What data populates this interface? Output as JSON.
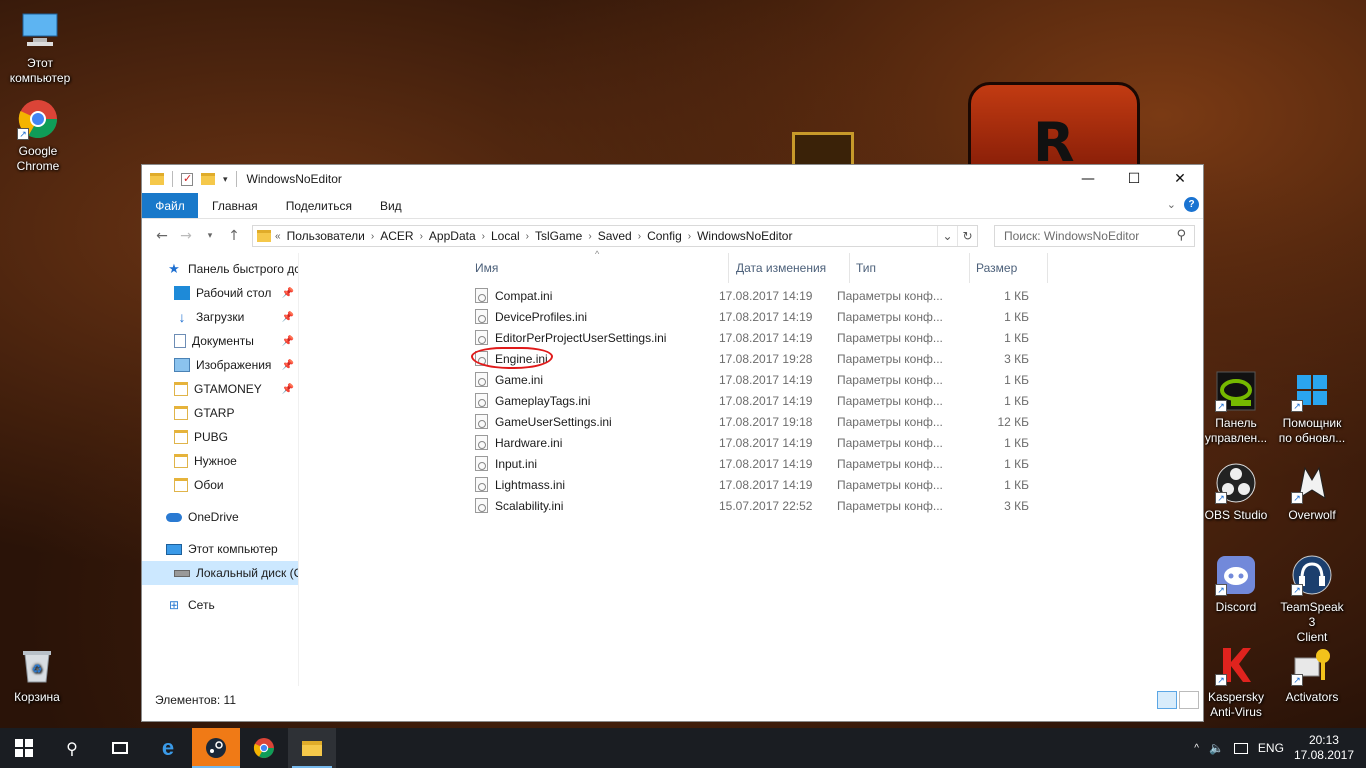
{
  "desktop": {
    "icons_left": [
      {
        "name": "this-pc",
        "label": "Этот\nкомпьютер"
      },
      {
        "name": "google-chrome",
        "label": "Google\nChrome"
      },
      {
        "name": "recycle-bin",
        "label": "Корзина"
      }
    ],
    "icons_right": [
      {
        "label": "Панель\nуправлен..."
      },
      {
        "label": "Помощник\nпо обновл..."
      },
      {
        "label": "OBS Studio"
      },
      {
        "label": "Overwolf"
      },
      {
        "label": "Discord"
      },
      {
        "label": "TeamSpeak 3\nClient"
      },
      {
        "label": "Kaspersky\nAnti-Virus"
      },
      {
        "label": "Activators"
      }
    ]
  },
  "window": {
    "title": "WindowsNoEditor",
    "ribbon_tabs": [
      "Файл",
      "Главная",
      "Поделиться",
      "Вид"
    ],
    "breadcrumbs": [
      "Пользователи",
      "ACER",
      "AppData",
      "Local",
      "TslGame",
      "Saved",
      "Config",
      "WindowsNoEditor"
    ],
    "breadcrumb_prefix": "«",
    "search_placeholder": "Поиск: WindowsNoEditor",
    "nav": {
      "quick_access": "Панель быстрого дс",
      "items": [
        {
          "label": "Рабочий стол",
          "pinned": true,
          "icon": "desktop"
        },
        {
          "label": "Загрузки",
          "pinned": true,
          "icon": "downloads"
        },
        {
          "label": "Документы",
          "pinned": true,
          "icon": "documents"
        },
        {
          "label": "Изображения",
          "pinned": true,
          "icon": "pictures"
        },
        {
          "label": "GTAMONEY",
          "pinned": true,
          "icon": "folder"
        },
        {
          "label": "GTARP",
          "pinned": false,
          "icon": "folder"
        },
        {
          "label": "PUBG",
          "pinned": false,
          "icon": "folder"
        },
        {
          "label": "Нужное",
          "pinned": false,
          "icon": "folder"
        },
        {
          "label": "Обои",
          "pinned": false,
          "icon": "folder"
        }
      ],
      "onedrive": "OneDrive",
      "this_pc": "Этот компьютер",
      "local_disk": "Локальный диск (C",
      "network": "Сеть"
    },
    "columns": {
      "name": "Имя",
      "date": "Дата изменения",
      "type": "Тип",
      "size": "Размер"
    },
    "files": [
      {
        "name": "Compat.ini",
        "date": "17.08.2017 14:19",
        "type": "Параметры конф...",
        "size": "1 КБ"
      },
      {
        "name": "DeviceProfiles.ini",
        "date": "17.08.2017 14:19",
        "type": "Параметры конф...",
        "size": "1 КБ"
      },
      {
        "name": "EditorPerProjectUserSettings.ini",
        "date": "17.08.2017 14:19",
        "type": "Параметры конф...",
        "size": "1 КБ"
      },
      {
        "name": "Engine.ini",
        "date": "17.08.2017 19:28",
        "type": "Параметры конф...",
        "size": "3 КБ",
        "highlighted": true
      },
      {
        "name": "Game.ini",
        "date": "17.08.2017 14:19",
        "type": "Параметры конф...",
        "size": "1 КБ"
      },
      {
        "name": "GameplayTags.ini",
        "date": "17.08.2017 14:19",
        "type": "Параметры конф...",
        "size": "1 КБ"
      },
      {
        "name": "GameUserSettings.ini",
        "date": "17.08.2017 19:18",
        "type": "Параметры конф...",
        "size": "12 КБ"
      },
      {
        "name": "Hardware.ini",
        "date": "17.08.2017 14:19",
        "type": "Параметры конф...",
        "size": "1 КБ"
      },
      {
        "name": "Input.ini",
        "date": "17.08.2017 14:19",
        "type": "Параметры конф...",
        "size": "1 КБ"
      },
      {
        "name": "Lightmass.ini",
        "date": "17.08.2017 14:19",
        "type": "Параметры конф...",
        "size": "1 КБ"
      },
      {
        "name": "Scalability.ini",
        "date": "15.07.2017 22:52",
        "type": "Параметры конф...",
        "size": "3 КБ"
      }
    ],
    "status": "Элементов: 11"
  },
  "taskbar": {
    "language": "ENG",
    "time": "20:13",
    "date": "17.08.2017"
  },
  "colors": {
    "accent": "#1979ca",
    "highlight_circle": "#e01a1a",
    "taskbar": "#1a1d22"
  }
}
